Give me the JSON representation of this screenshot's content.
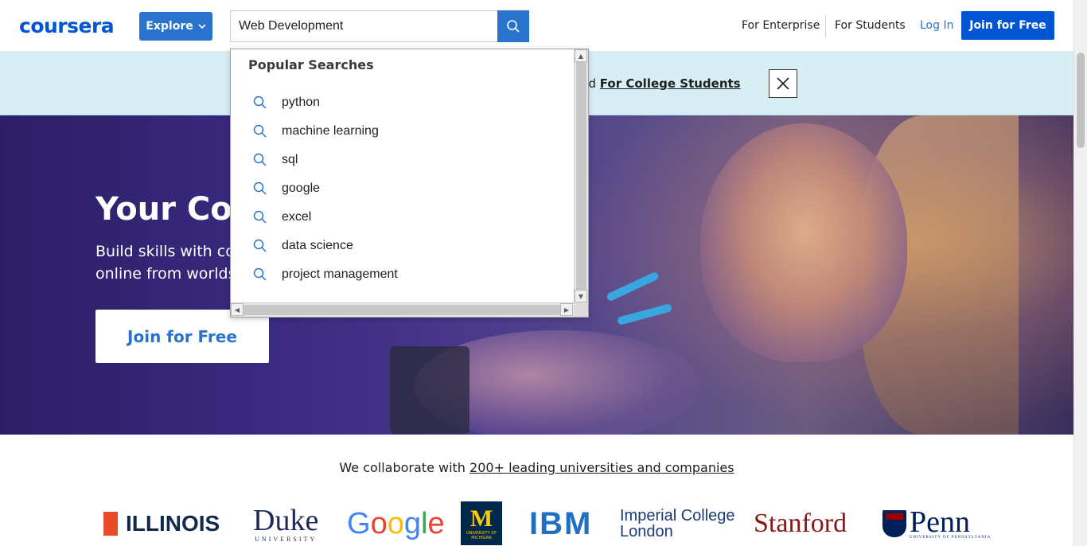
{
  "header": {
    "logo": "coursera",
    "explore_label": "Explore",
    "search_value": "Web Development",
    "nav_enterprise": "For Enterprise",
    "nav_students": "For Students",
    "login": "Log In",
    "join": "Join for Free"
  },
  "banner": {
    "text_fragment": "nd ",
    "link": "For College Students"
  },
  "hero": {
    "title": "Your Cou",
    "subtitle_line1": "Build skills with co",
    "subtitle_line2": "online from worlds",
    "cta": "Join for Free"
  },
  "dropdown": {
    "title": "Popular Searches",
    "items": [
      {
        "label": "python"
      },
      {
        "label": "machine learning"
      },
      {
        "label": "sql"
      },
      {
        "label": "google"
      },
      {
        "label": "excel"
      },
      {
        "label": "data science"
      },
      {
        "label": "project management"
      }
    ]
  },
  "partners": {
    "intro": "We collaborate with ",
    "intro_link": "200+ leading universities and companies",
    "illinois": "ILLINOIS",
    "duke": "Duke",
    "duke_sub": "UNIVERSITY",
    "google_letters": [
      "G",
      "o",
      "o",
      "g",
      "l",
      "e"
    ],
    "google_colors": [
      "#4285f4",
      "#ea4335",
      "#fbbc05",
      "#4285f4",
      "#34a853",
      "#ea4335"
    ],
    "michigan_mark": "M",
    "michigan_sub": "UNIVERSITY OF MICHIGAN",
    "ibm": "IBM",
    "imperial_line1": "Imperial College",
    "imperial_line2": "London",
    "stanford": "Stanford",
    "penn": "Penn",
    "penn_sub": "UNIVERSITY OF PENNSYLVANIA"
  },
  "colors": {
    "brand": "#0056d2",
    "accent": "#2a73cc",
    "banner_bg": "#d7eef5"
  }
}
